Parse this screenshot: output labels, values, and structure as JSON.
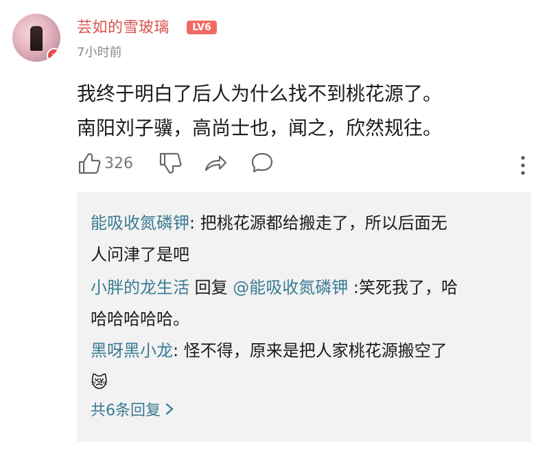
{
  "user": {
    "name": "芸如的雪玻璃",
    "level": "LV6",
    "time_ago": "7小时前"
  },
  "comment": {
    "lines": [
      "我终于明白了后人为什么找不到桃花源了。",
      "南阳刘子骥，高尚士也，闻之，欣然规往。"
    ],
    "likes": "326"
  },
  "replies": [
    {
      "user": "能吸收氮磷钾",
      "sep": ":",
      "text_line1": " 把桃花源都给搬走了，所以后面无",
      "text_line2": "人问津了是吧"
    },
    {
      "user": "小胖的龙生活",
      "reply_word": " 回复 ",
      "mention": "@能吸收氮磷钾",
      "text_line1": " :笑死我了，哈",
      "text_line2": "哈哈哈哈哈。"
    },
    {
      "user": "黑呀黑小龙",
      "sep": ":",
      "text_line1": " 怪不得，原来是把人家桃花源搬空了",
      "emoji": "😿"
    }
  ],
  "more_replies_label": "共6条回复",
  "icons": {
    "like": "thumbs-up-icon",
    "dislike": "thumbs-down-icon",
    "share": "share-icon",
    "reply": "chat-bubble-icon",
    "more": "more-vertical-icon",
    "avatar_badge": "add-icon",
    "chevron": "chevron-right-icon"
  },
  "colors": {
    "username": "#d9534f",
    "level_badge": "#f06b63",
    "reply_name": "#3a7b93",
    "panel_bg": "#f2f2f2",
    "muted": "#8a8a8a"
  }
}
